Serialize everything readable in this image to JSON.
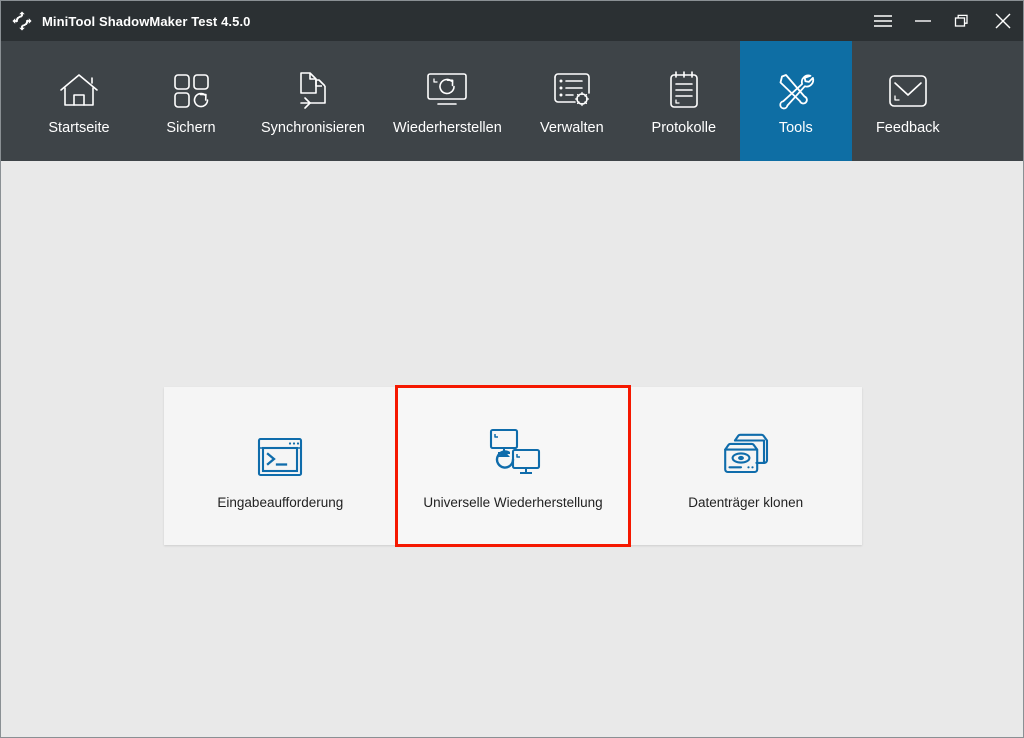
{
  "window": {
    "title": "MiniTool ShadowMaker Test 4.5.0",
    "logo_icon": "refresh-arrows-logo",
    "controls": [
      {
        "name": "menu-button",
        "icon": "hamburger-menu-icon",
        "label": "Menu"
      },
      {
        "name": "minimize-button",
        "icon": "minimize-icon",
        "label": "Minimize"
      },
      {
        "name": "restore-button",
        "icon": "restore-window-icon",
        "label": "Restore"
      },
      {
        "name": "close-button",
        "icon": "close-icon",
        "label": "Close"
      }
    ]
  },
  "nav": {
    "active_index": 6,
    "active_color": "#0e6ea4",
    "items": [
      {
        "label": "Startseite",
        "icon": "home-icon"
      },
      {
        "label": "Sichern",
        "icon": "backup-squares-icon"
      },
      {
        "label": "Synchronisieren",
        "icon": "sync-files-icon"
      },
      {
        "label": "Wiederherstellen",
        "icon": "restore-monitor-icon"
      },
      {
        "label": "Verwalten",
        "icon": "manage-list-gear-icon"
      },
      {
        "label": "Protokolle",
        "icon": "logs-clipboard-icon"
      },
      {
        "label": "Tools",
        "icon": "tools-wrench-screwdriver-icon"
      },
      {
        "label": "Feedback",
        "icon": "envelope-icon"
      }
    ]
  },
  "main": {
    "background_color": "#e9e9e9",
    "card_color": "#f5f5f5",
    "icon_color": "#0f6cab",
    "selection_color": "#f51800",
    "selected_index": 1,
    "cards": [
      {
        "label": "Eingabeaufforderung",
        "icon": "command-prompt-icon",
        "selected": false
      },
      {
        "label": "Universelle Wiederherstellung",
        "icon": "universal-restore-icon",
        "selected": true
      },
      {
        "label": "Datenträger klonen",
        "icon": "clone-disk-icon",
        "selected": false
      }
    ]
  }
}
